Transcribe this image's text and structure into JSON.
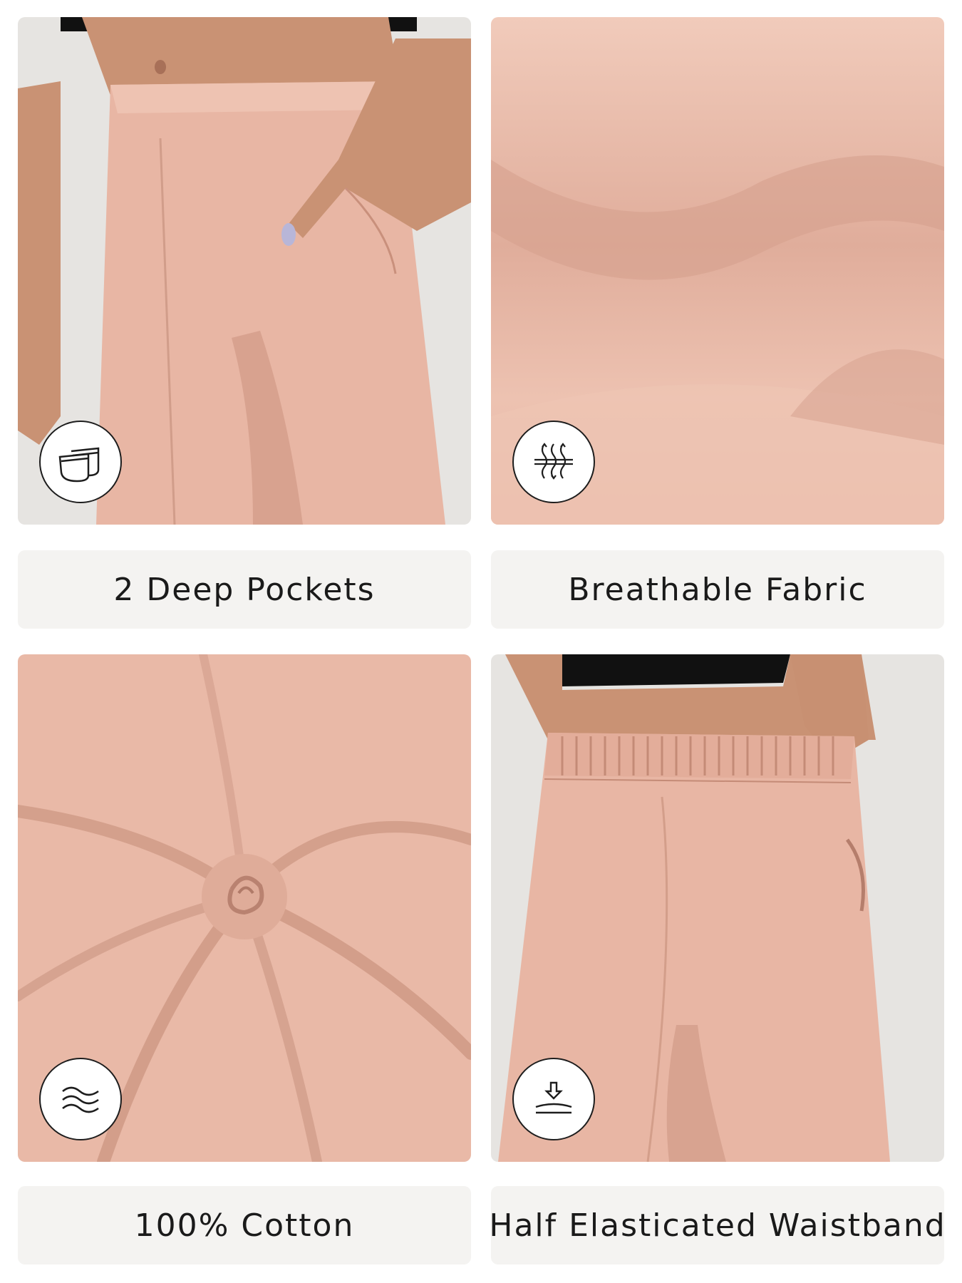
{
  "features": [
    {
      "caption": "2 Deep Pockets",
      "icon": "pocket-icon",
      "image": "pocket-photo"
    },
    {
      "caption": "Breathable Fabric",
      "icon": "breathable-airflow-icon",
      "image": "fabric-closeup-photo"
    },
    {
      "caption": "100% Cotton",
      "icon": "soft-waves-icon",
      "image": "fabric-swirl-photo"
    },
    {
      "caption": "Half Elasticated Waistband",
      "icon": "stretch-arrow-icon",
      "image": "waistband-photo"
    }
  ],
  "colors": {
    "fabric": "#e8b6a4",
    "fabric_light": "#f0c8b8",
    "fabric_shadow": "#c8907c",
    "caption_bg": "#f4f3f1",
    "skin": "#c89072",
    "top_black": "#111111"
  }
}
